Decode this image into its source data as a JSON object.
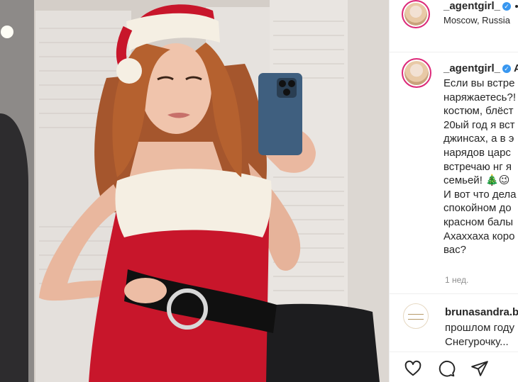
{
  "post": {
    "author": "_agentgirl_",
    "verified_icon": "verified-badge-icon",
    "location": "Moscow, Russia",
    "caption": "Если вы встре\nнаряжаетесь?!\nкостюм, блёст\n20ый год я вст\nджинсах, а в э\nнарядов царс\nвстречаю нг я\nсемьей! 🎄😉\nИ вот что дела\nспокойном до\nкрасном балы\nАхаххаха коро\nвас?",
    "time_ago": "1 нед."
  },
  "comment": {
    "username": "brunasandra.b",
    "text": "прошлом году\nСнегурочку..."
  },
  "icons": {
    "like": "heart-icon",
    "comment": "comment-icon",
    "share": "share-icon",
    "more": "more-options-icon"
  },
  "colors": {
    "accent_blue": "#3897f0",
    "story_ring": "#dd2a7b",
    "santa_red": "#c8162b",
    "fur_white": "#f5efe3"
  }
}
